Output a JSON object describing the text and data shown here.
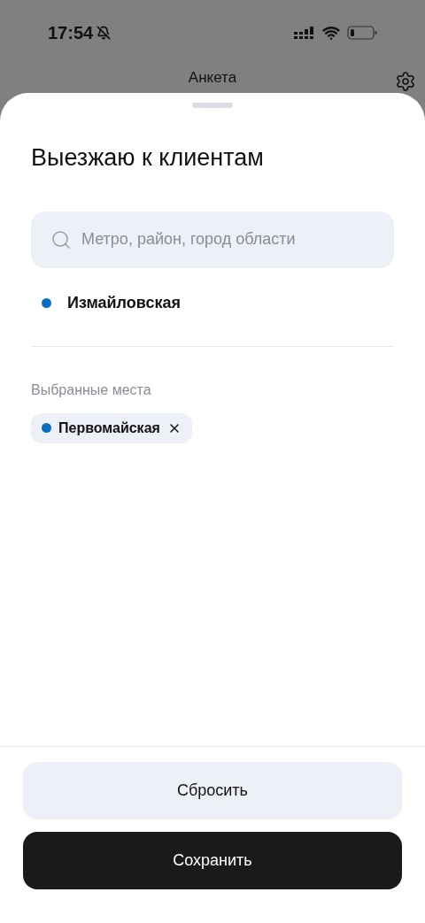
{
  "status_bar": {
    "time": "17:54"
  },
  "header": {
    "title": "Анкета"
  },
  "sheet": {
    "title": "Выезжаю к клиентам",
    "search": {
      "placeholder": "Метро, район, город области"
    },
    "results": [
      {
        "name": "Измайловская",
        "color": "#0a6fc2"
      }
    ],
    "selected_label": "Выбранные места",
    "selected_places": [
      {
        "name": "Первомайская",
        "color": "#0a6fc2"
      }
    ],
    "buttons": [
      {
        "label": "Сбросить",
        "kind": "secondary"
      },
      {
        "label": "Сохранить",
        "kind": "primary"
      }
    ]
  }
}
